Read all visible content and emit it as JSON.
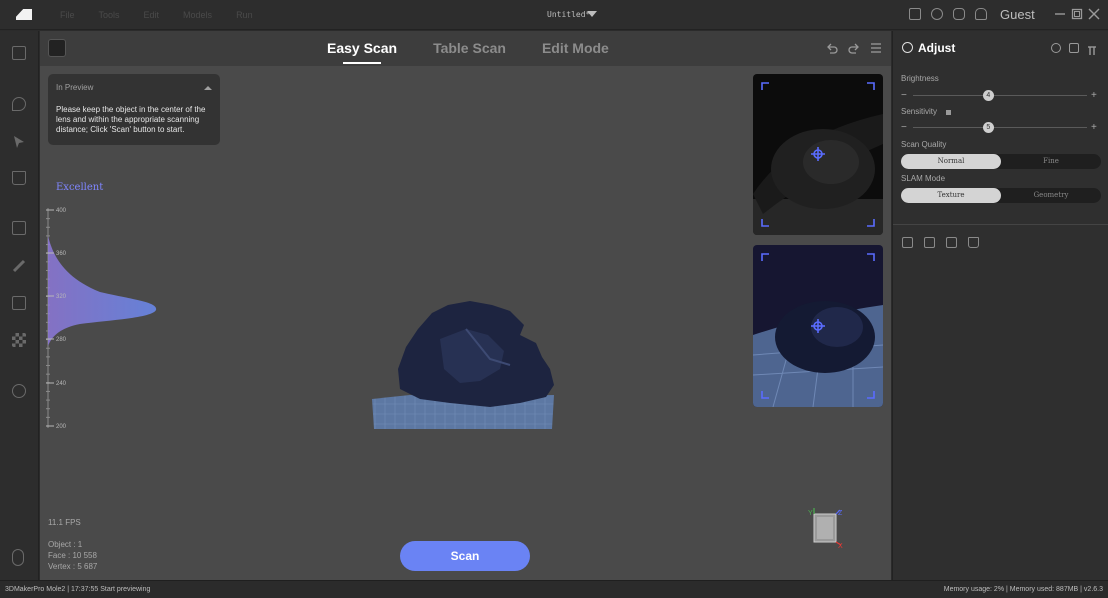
{
  "titlebar": {
    "menu": [
      "File",
      "Tools",
      "Edit",
      "Models",
      "Run"
    ],
    "doc_title": "Untitled*",
    "user": "Guest",
    "icons": [
      "book-icon",
      "sync-icon",
      "feedback-icon",
      "bell-icon"
    ]
  },
  "left_toolbar": {
    "icons": [
      "select-box-icon",
      "lasso-icon",
      "pointer-icon",
      "trash-icon",
      "copy-icon",
      "brush-icon",
      "square-icon",
      "checker-icon",
      "layers-icon",
      "mouse-icon"
    ]
  },
  "viewport": {
    "tabs": [
      {
        "label": "Easy Scan",
        "active": true
      },
      {
        "label": "Table Scan",
        "active": false
      },
      {
        "label": "Edit Mode",
        "active": false
      }
    ],
    "preview_card": {
      "title": "In Preview",
      "message": "Please keep the object in the center of the lens and within the appropriate scanning distance; Click 'Scan' button to start."
    },
    "distance": {
      "quality": "Excellent",
      "ticks": [
        "400",
        "360",
        "320",
        "280",
        "240",
        "200"
      ]
    },
    "stats": {
      "fps": "11.1 FPS",
      "object": "Object : 1",
      "face": "Face : 10 558",
      "vertex": "Vertex : 5 687"
    },
    "scan_button": "Scan",
    "axis": {
      "y": "Y",
      "z": "Z",
      "x": "X"
    }
  },
  "adjust_panel": {
    "title": "Adjust",
    "brightness": {
      "label": "Brightness",
      "value": "4",
      "level": 0.43
    },
    "sensitivity": {
      "label": "Sensitivity",
      "value": "5",
      "level": 0.43
    },
    "scan_quality": {
      "label": "Scan Quality",
      "options": [
        "Normal",
        "Fine"
      ],
      "selected": "Normal"
    },
    "slam_mode": {
      "label": "SLAM Mode",
      "options": [
        "Texture",
        "Geometry"
      ],
      "selected": "Texture"
    }
  },
  "statusbar": {
    "left": "3DMakerPro Mole2 | 17:37:55 Start previewing",
    "right": "Memory usage: 2% | Memory used: 887MB | v2.6.3"
  },
  "colors": {
    "accent": "#6a83f4",
    "excellent": "#7f86ff"
  }
}
